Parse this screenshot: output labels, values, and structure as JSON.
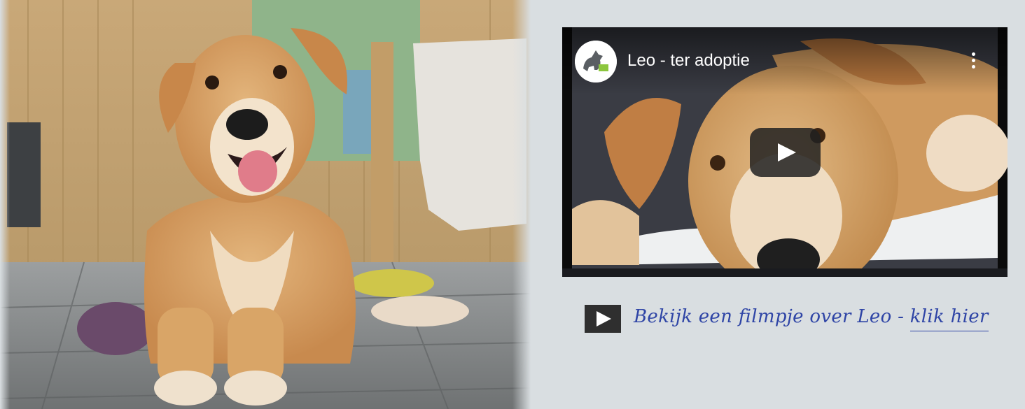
{
  "video": {
    "title": "Leo - ter adoptie",
    "channel_icon": "dog-logo-icon",
    "menu_icon": "more-vertical-icon",
    "play_icon": "play-icon"
  },
  "watch_link": {
    "prefix": "Bekijk een filmpje over Leo - ",
    "link_label": "klik hier",
    "icon": "play-icon"
  },
  "colors": {
    "background": "#d9dee1",
    "link": "#2f45a6",
    "play_button": "#212121"
  }
}
